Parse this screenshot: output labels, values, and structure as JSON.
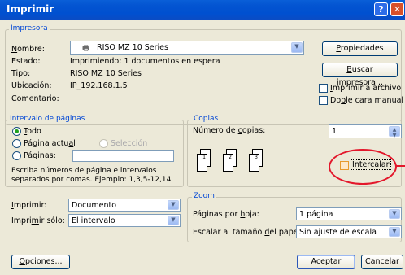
{
  "window": {
    "title": "Imprimir",
    "help_glyph": "?",
    "close_glyph": "✕"
  },
  "printer": {
    "group_label": "Impresora",
    "name_label": "Nombre:",
    "name_value": "RISO MZ 10 Series",
    "status_label": "Estado:",
    "status_value": "Imprimiendo: 1 documentos en espera",
    "type_label": "Tipo:",
    "type_value": "RISO MZ 10 Series",
    "location_label": "Ubicación:",
    "location_value": "IP_192.168.1.5",
    "comment_label": "Comentario:",
    "properties_button": "Propiedades",
    "find_printer_button": "Buscar impresora...",
    "print_to_file": "Imprimir a archivo",
    "manual_duplex": "Doble cara manual"
  },
  "page_range": {
    "group_label": "Intervalo de páginas",
    "all": "Todo",
    "current_page": "Página actual",
    "selection": "Selección",
    "pages": "Páginas:",
    "hint": "Escriba números de página e intervalos separados por comas. Ejemplo: 1,3,5-12,14"
  },
  "copies": {
    "group_label": "Copias",
    "count_label": "Número de copias:",
    "count_value": "1",
    "collate": "Intercalar",
    "page_numbers": [
      "1",
      "2",
      "3"
    ]
  },
  "print_what": {
    "label": "Imprimir:",
    "value": "Documento"
  },
  "print_only": {
    "label": "Imprimir sólo:",
    "value": "El intervalo"
  },
  "zoom": {
    "group_label": "Zoom",
    "pages_per_sheet_label": "Páginas por hoja:",
    "pages_per_sheet_value": "1 página",
    "scale_label": "Escalar al tamaño del papel:",
    "scale_value": "Sin ajuste de escala"
  },
  "footer": {
    "options_button": "Opciones...",
    "ok_button": "Aceptar",
    "cancel_button": "Cancelar"
  },
  "colors": {
    "title_bar": "#0054e3",
    "group_label": "#0046d5",
    "highlight_circle": "#e3172b"
  }
}
